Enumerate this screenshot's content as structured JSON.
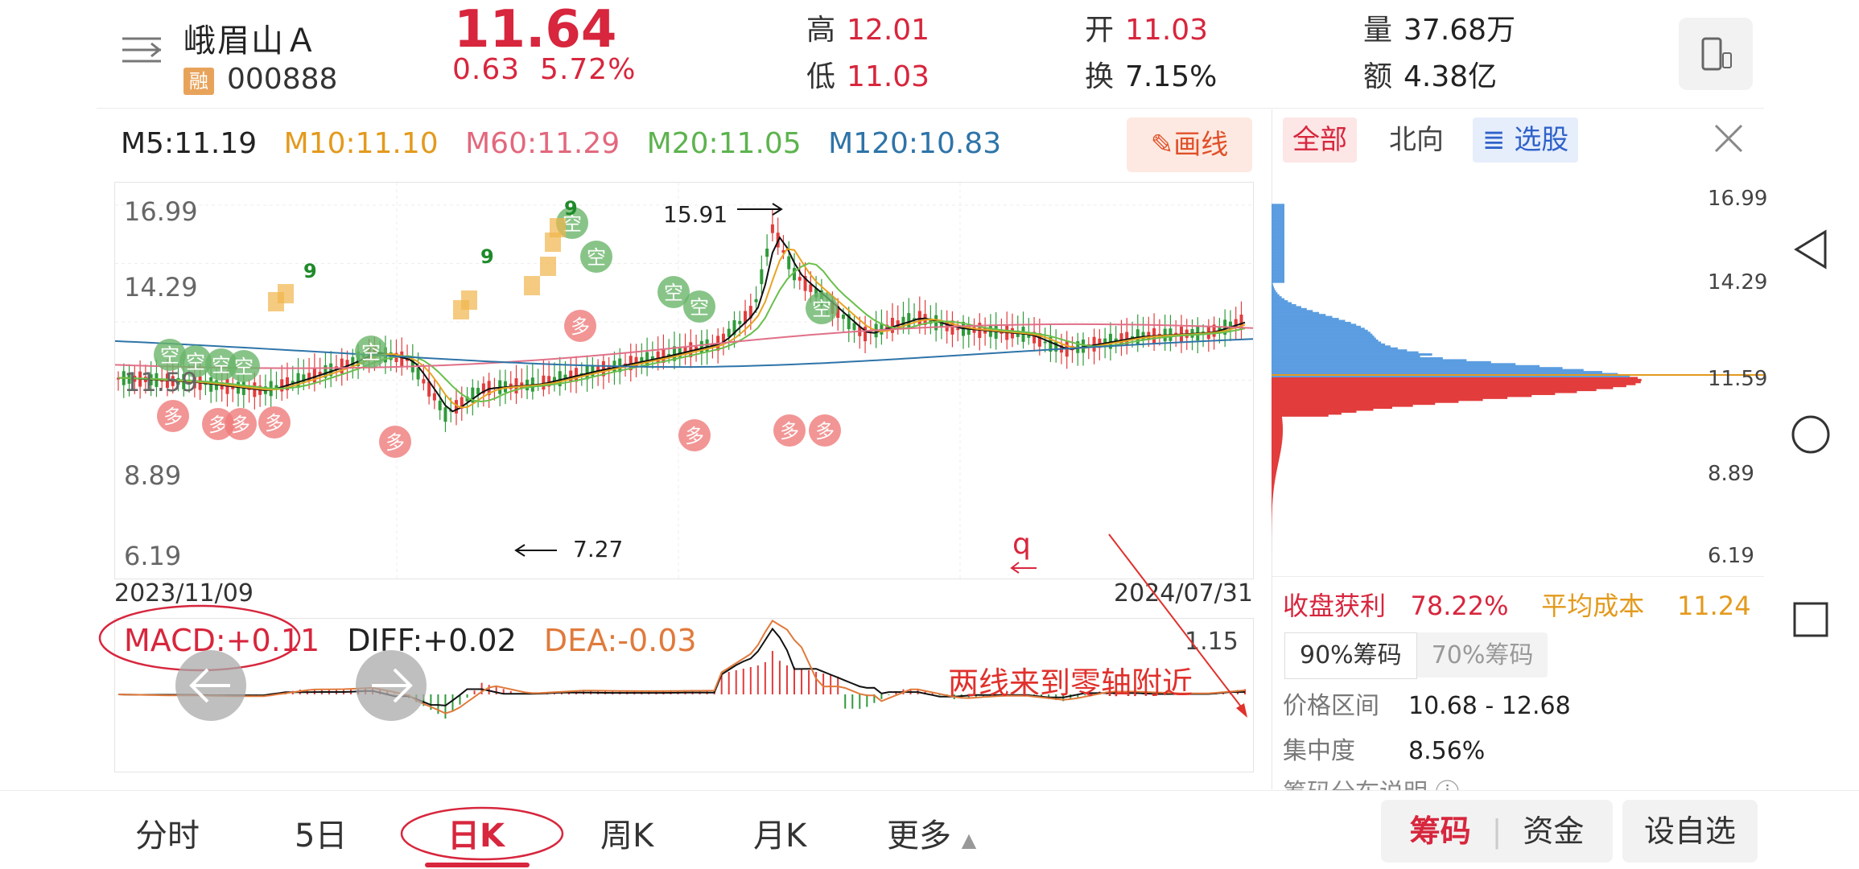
{
  "header": {
    "stock_name": "峨眉山Ａ",
    "margin_badge": "融",
    "code": "000888",
    "price": "11.64",
    "change": "0.63",
    "change_pct": "5.72%",
    "high_label": "高",
    "high": "12.01",
    "low_label": "低",
    "low": "11.03",
    "open_label": "开",
    "open": "11.03",
    "turnover_label": "换",
    "turnover": "7.15%",
    "volume_label": "量",
    "volume": "37.68万",
    "amount_label": "额",
    "amount": "4.38亿",
    "menu_icon": "menu-icon",
    "phone_icon": "phone-layout-icon"
  },
  "ma_legend": {
    "m5": "M5:11.19",
    "m10": "M10:11.10",
    "m60": "M60:11.29",
    "m20": "M20:11.05",
    "m120": "M120:10.83"
  },
  "draw_button": "画线",
  "chart": {
    "y_labels": [
      "16.99",
      "14.29",
      "11.59",
      "8.89",
      "6.19"
    ],
    "high_annotation": "15.91",
    "low_annotation": "7.27",
    "date_start": "2023/11/09",
    "date_end": "2024/07/31",
    "kong_label": "空",
    "duo_label": "多",
    "nine_label": "9",
    "scribble": "q",
    "colors": {
      "up": "#e23c3c",
      "down": "#2f9b3a",
      "m5": "#111111",
      "m10": "#e8a321",
      "m20": "#6abf4b",
      "m60": "#e07088",
      "m120": "#2e74a8"
    }
  },
  "macd": {
    "macd": "MACD:+0.11",
    "diff": "DIFF:+0.02",
    "dea": "DEA:-0.03",
    "top_value": "1.15",
    "annotation": "两线来到零轴附近"
  },
  "right_panel": {
    "tabs": [
      "全部",
      "北向",
      "选股"
    ],
    "price_labels": [
      "16.99",
      "14.29",
      "11.59",
      "8.89",
      "6.19"
    ],
    "profit_label": "收盘获利",
    "profit_value": "78.22%",
    "avg_cost_label": "平均成本",
    "avg_cost_value": "11.24",
    "chip_tabs": [
      "90%筹码",
      "70%筹码"
    ],
    "range_label": "价格区间",
    "range_value": "10.68 - 12.68",
    "concentration_label": "集中度",
    "concentration_value": "8.56%",
    "desc_label": "筹码分布说明"
  },
  "bottom_tabs": [
    "分时",
    "5日",
    "日K",
    "周K",
    "月K",
    "更多"
  ],
  "bottom_buttons": {
    "chips": "筹码",
    "funds": "资金",
    "watchlist": "设自选"
  }
}
